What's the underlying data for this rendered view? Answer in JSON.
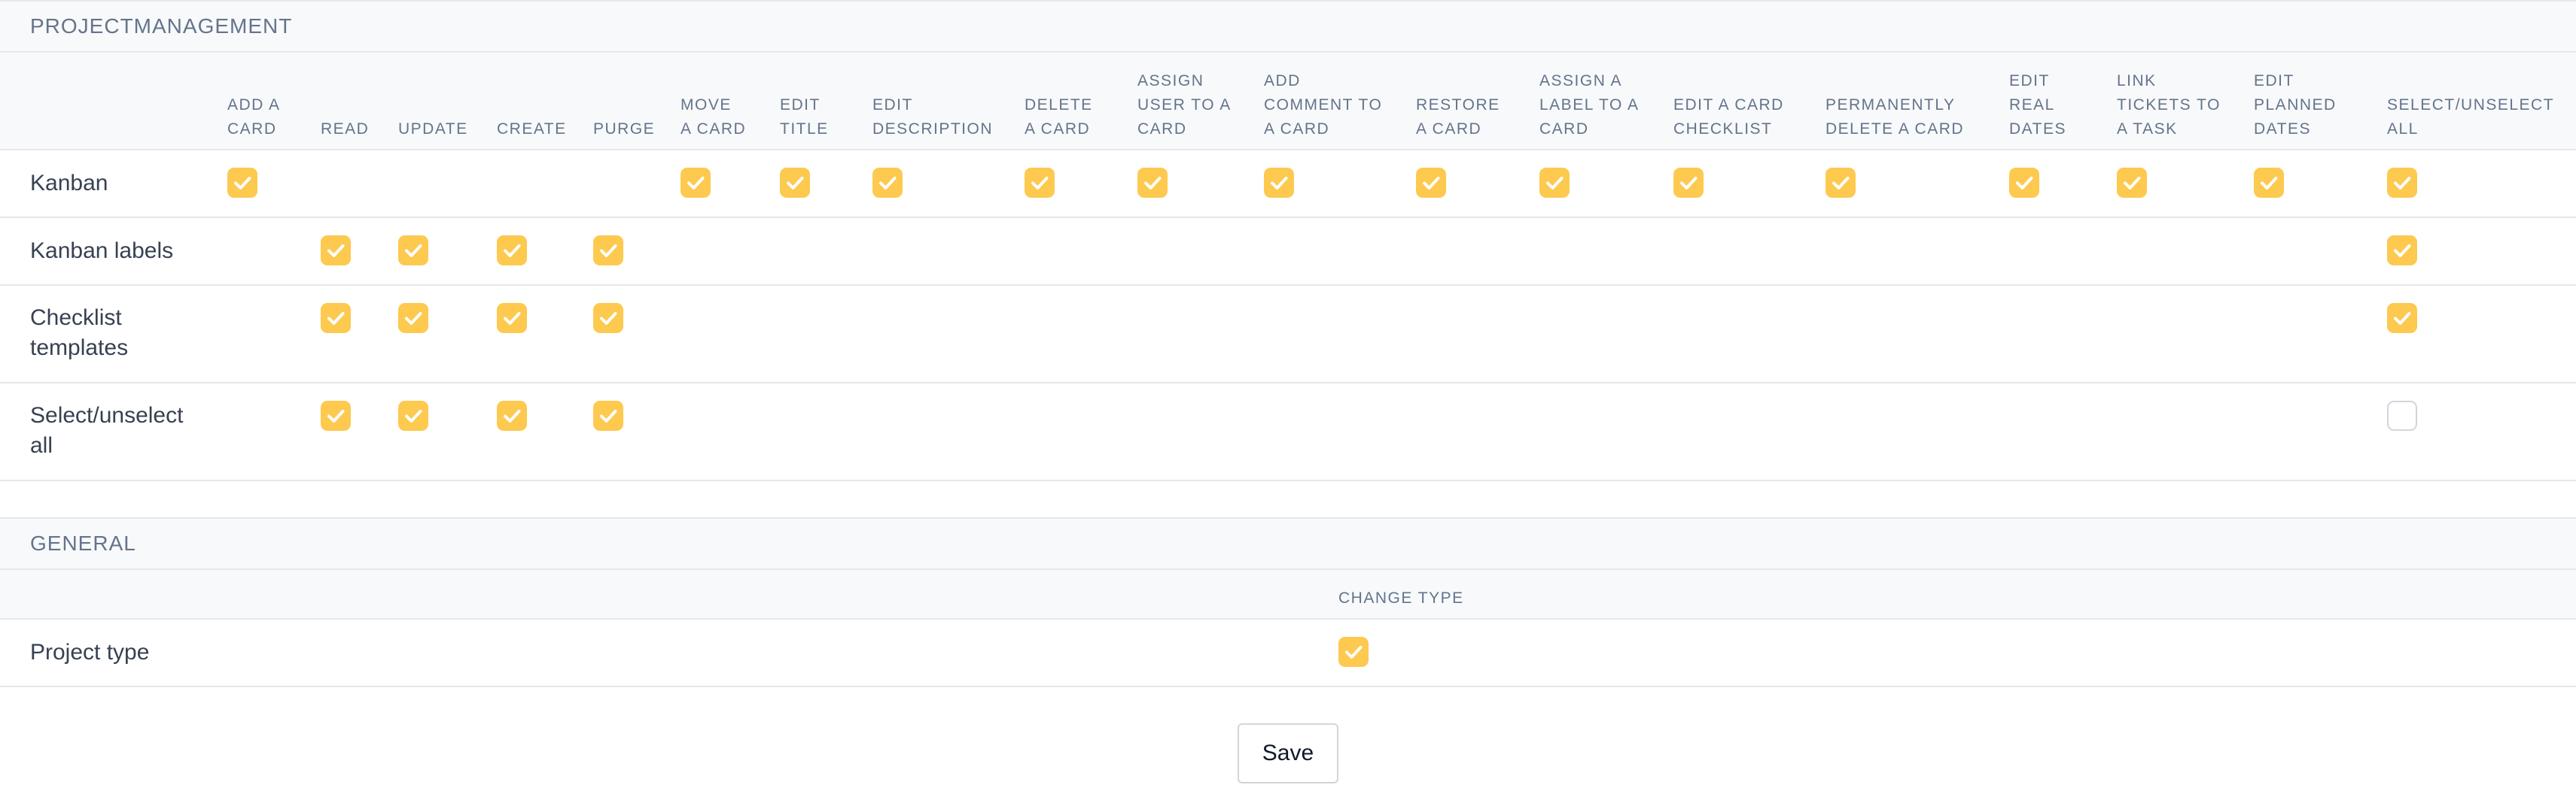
{
  "sections": {
    "project_management": {
      "title": "PROJECTMANAGEMENT",
      "columns": [
        "ADD A\nCARD",
        "READ",
        "UPDATE",
        "CREATE",
        "PURGE",
        "MOVE\nA CARD",
        "EDIT\nTITLE",
        "EDIT\nDESCRIPTION",
        "DELETE\nA CARD",
        "ASSIGN\nUSER TO A\nCARD",
        "ADD\nCOMMENT TO\nA CARD",
        "RESTORE\nA CARD",
        "ASSIGN A\nLABEL TO A\nCARD",
        "EDIT A CARD\nCHECKLIST",
        "PERMANENTLY\nDELETE A CARD",
        "EDIT\nREAL\nDATES",
        "LINK\nTICKETS TO\nA TASK",
        "EDIT\nPLANNED\nDATES",
        "SELECT/UNSELECT\nALL"
      ],
      "rows": [
        {
          "label": "Kanban",
          "checks": [
            true,
            null,
            null,
            null,
            null,
            true,
            true,
            true,
            true,
            true,
            true,
            true,
            true,
            true,
            true,
            true,
            true,
            true,
            true
          ]
        },
        {
          "label": "Kanban labels",
          "checks": [
            null,
            true,
            true,
            true,
            true,
            null,
            null,
            null,
            null,
            null,
            null,
            null,
            null,
            null,
            null,
            null,
            null,
            null,
            true
          ]
        },
        {
          "label": "Checklist\ntemplates",
          "checks": [
            null,
            true,
            true,
            true,
            true,
            null,
            null,
            null,
            null,
            null,
            null,
            null,
            null,
            null,
            null,
            null,
            null,
            null,
            true
          ]
        },
        {
          "label": "Select/unselect\nall",
          "checks": [
            null,
            true,
            true,
            true,
            true,
            null,
            null,
            null,
            null,
            null,
            null,
            null,
            null,
            null,
            null,
            null,
            null,
            null,
            false
          ]
        }
      ]
    },
    "general": {
      "title": "GENERAL",
      "columns": [
        "CHANGE TYPE"
      ],
      "rows": [
        {
          "label": "Project type",
          "checks": [
            true
          ]
        }
      ]
    }
  },
  "save_label": "Save",
  "colors": {
    "checked": "#fdc94f",
    "check_mark": "#ffffff",
    "header_bg": "#f8f9fb",
    "border": "#e5e7eb"
  },
  "icons": {
    "checked": "checkmark-icon"
  }
}
